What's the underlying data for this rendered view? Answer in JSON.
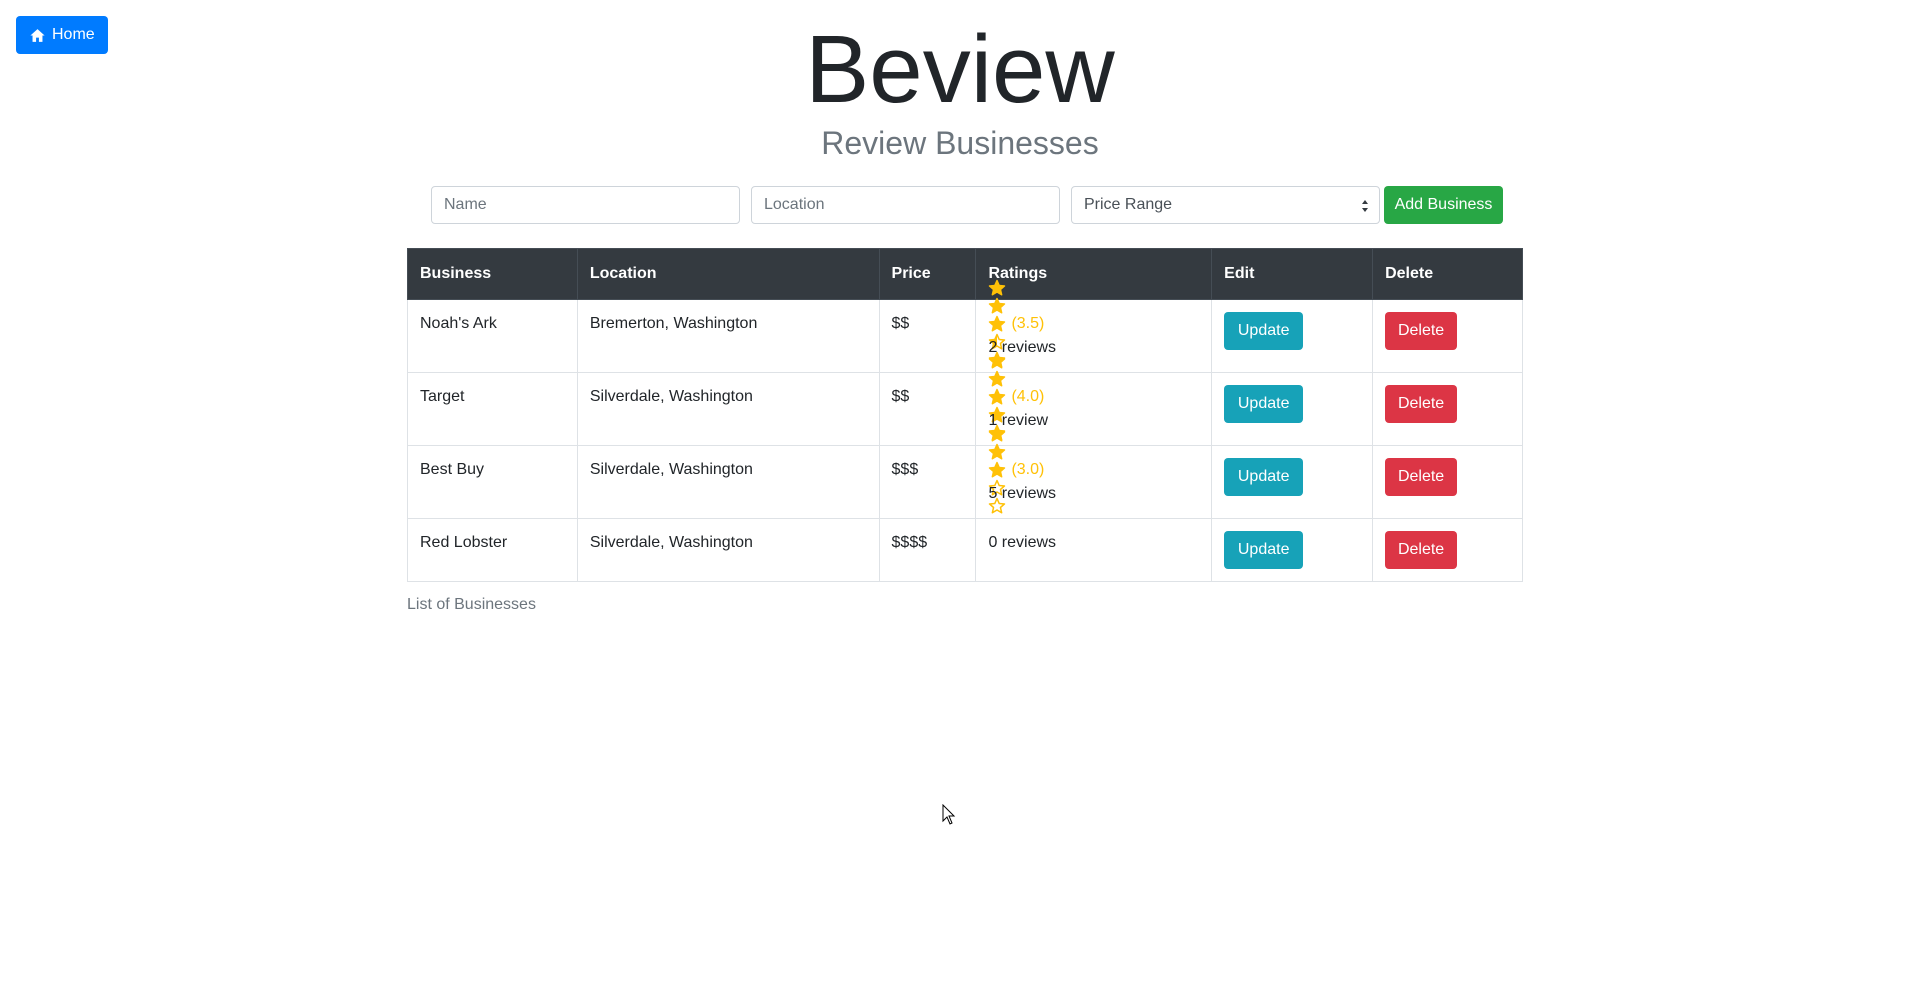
{
  "nav": {
    "home_label": "Home",
    "home_icon": "home-icon"
  },
  "header": {
    "title": "Beview",
    "subtitle": "Review Businesses"
  },
  "form": {
    "name_placeholder": "Name",
    "location_placeholder": "Location",
    "price_selected": "Price Range",
    "add_label": "Add Business"
  },
  "table": {
    "headers": [
      "Business",
      "Location",
      "Price",
      "Ratings",
      "Edit",
      "Delete"
    ],
    "rows": [
      {
        "business": "Noah's Ark",
        "location": "Bremerton, Washington",
        "price": "$$",
        "rating": 3.5,
        "rating_label": "(3.5)",
        "reviews": "2 reviews",
        "update_label": "Update",
        "delete_label": "Delete"
      },
      {
        "business": "Target",
        "location": "Silverdale, Washington",
        "price": "$$",
        "rating": 4.0,
        "rating_label": "(4.0)",
        "reviews": "1 review",
        "update_label": "Update",
        "delete_label": "Delete"
      },
      {
        "business": "Best Buy",
        "location": "Silverdale, Washington",
        "price": "$$$",
        "rating": 3.0,
        "rating_label": "(3.0)",
        "reviews": "5 reviews",
        "update_label": "Update",
        "delete_label": "Delete"
      },
      {
        "business": "Red Lobster",
        "location": "Silverdale, Washington",
        "price": "$$$$",
        "rating": null,
        "rating_label": "",
        "reviews": "0 reviews",
        "update_label": "Update",
        "delete_label": "Delete"
      }
    ],
    "caption": "List of Businesses"
  },
  "colors": {
    "primary": "#007bff",
    "success": "#28a745",
    "info": "#17a2b8",
    "danger": "#dc3545",
    "star": "#ffc107",
    "table_header": "#343a40"
  }
}
